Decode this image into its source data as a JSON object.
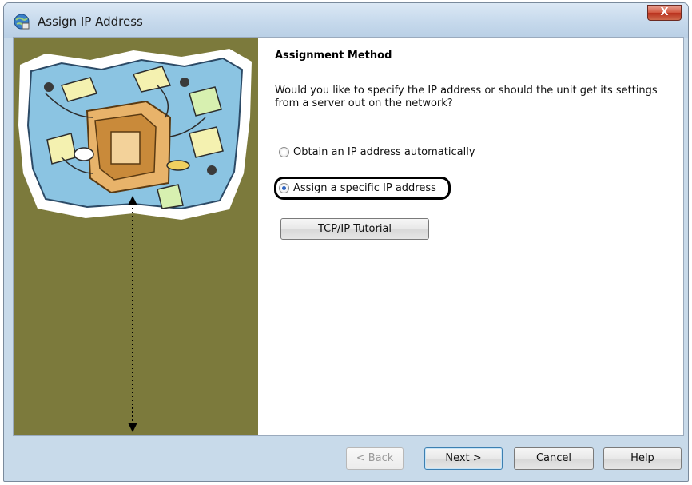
{
  "window": {
    "title": "Assign IP Address",
    "close_label": "X"
  },
  "icons": {
    "app": "network-globe-icon",
    "close": "close-icon"
  },
  "content": {
    "heading": "Assignment Method",
    "question": "Would you like to specify the IP address or should the unit get its settings from a server out on the network?",
    "options": [
      {
        "label": "Obtain an IP address automatically",
        "selected": false
      },
      {
        "label": "Assign a specific IP address",
        "selected": true
      }
    ],
    "tutorial_button": "TCP/IP Tutorial"
  },
  "buttons": {
    "back": "< Back",
    "next": "Next >",
    "cancel": "Cancel",
    "help": "Help"
  },
  "colors": {
    "side_panel": "#7c7a3c",
    "title_bar": "#c6d9ec",
    "close_button": "#c8432a",
    "selected_radio": "#2f64c0"
  }
}
